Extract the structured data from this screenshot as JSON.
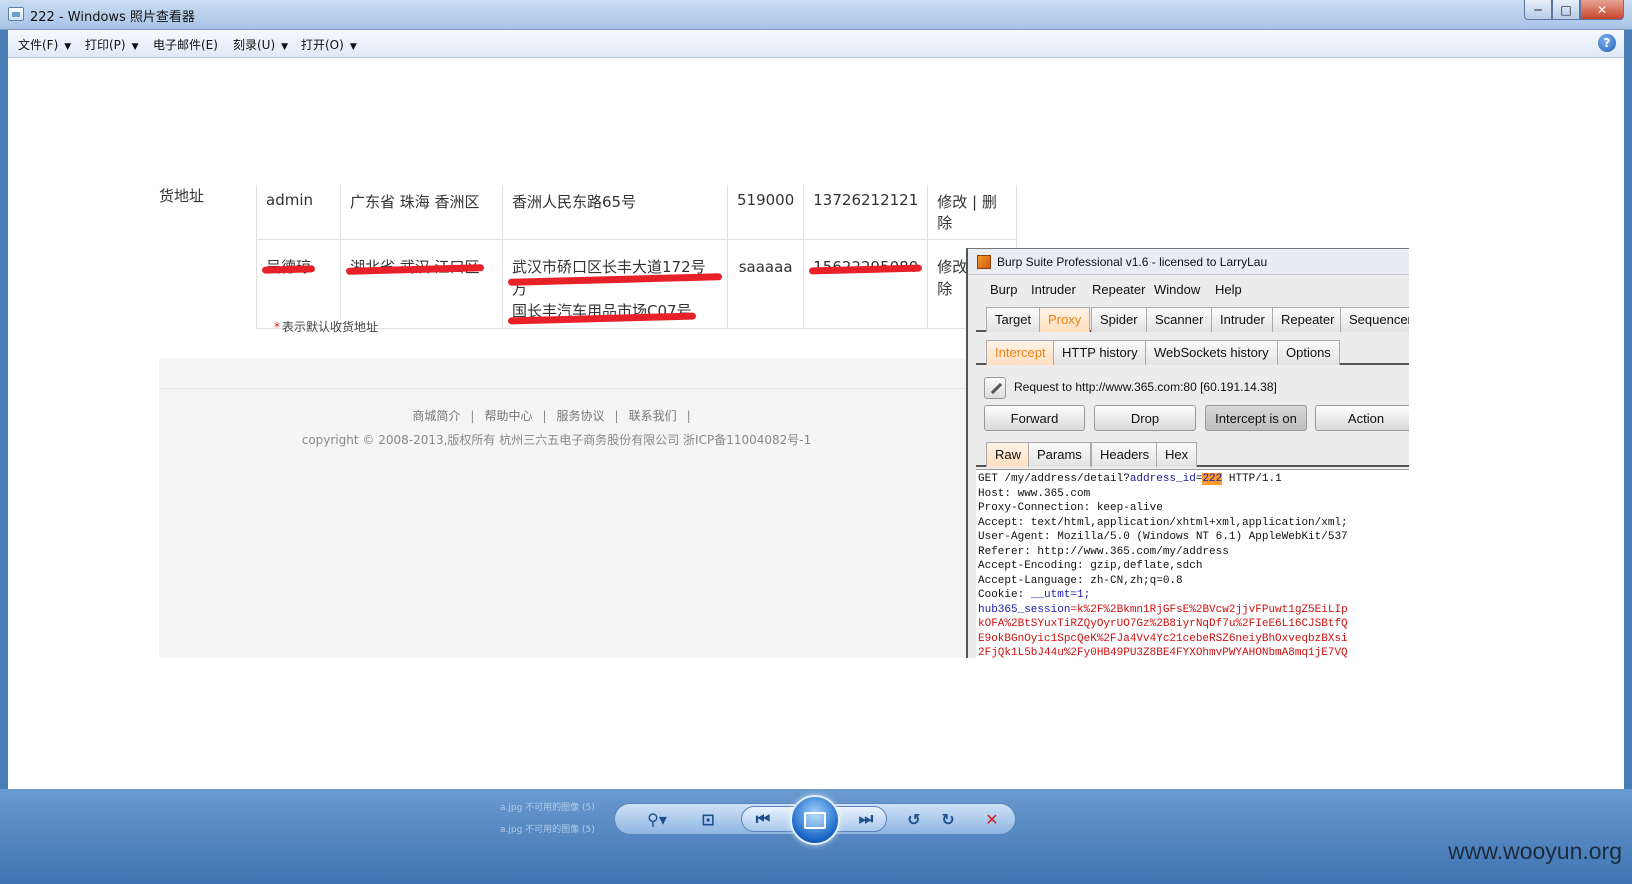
{
  "window": {
    "title": "222 - Windows 照片查看器",
    "minimize": "─",
    "maximize": "□",
    "close": "✕"
  },
  "menu": {
    "file": "文件(F)",
    "print": "打印(P)",
    "email": "电子邮件(E)",
    "burn": "刻录(U)",
    "open": "打开(O)",
    "help": "?"
  },
  "webpage": {
    "side_label": "货地址",
    "rows": [
      {
        "name": "admin",
        "region": "广东省 珠海 香洲区",
        "street": "香洲人民东路65号",
        "street2": "",
        "zip": "519000",
        "phone": "13726212121",
        "actions": "修改 | 删除"
      },
      {
        "name": "吴德琼",
        "region": "湖北省 武汉 江口区",
        "street": "武汉市硚口区长丰大道172号万",
        "street2": "国长丰汽车用品市场C07号",
        "zip": "saaaaa",
        "phone": "15622295080",
        "actions": "修改 | 删除"
      }
    ],
    "note_star": "*",
    "note": "表示默认收货地址",
    "footer_links": [
      "商城简介",
      "帮助中心",
      "服务协议",
      "联系我们"
    ],
    "footer_sep": "|",
    "copyright": "copyright © 2008-2013,版权所有 杭州三六五电子商务股份有限公司 浙ICP备11004082号-1"
  },
  "burp": {
    "title": "Burp Suite Professional v1.6 - licensed to LarryLau",
    "menu": [
      "Burp",
      "Intruder",
      "Repeater",
      "Window",
      "Help"
    ],
    "tabs": [
      "Target",
      "Proxy",
      "Spider",
      "Scanner",
      "Intruder",
      "Repeater",
      "Sequencer"
    ],
    "active_tab": "Proxy",
    "subtabs": [
      "Intercept",
      "HTTP history",
      "WebSockets history",
      "Options"
    ],
    "active_subtab": "Intercept",
    "request_info": "Request to http://www.365.com:80  [60.191.14.38]",
    "buttons": {
      "forward": "Forward",
      "drop": "Drop",
      "intercept": "Intercept is on",
      "action": "Action"
    },
    "view_tabs": [
      "Raw",
      "Params",
      "Headers",
      "Hex"
    ],
    "active_view_tab": "Raw",
    "request": {
      "method_path": "GET /my/address/detail?",
      "param_name": "address_id",
      "param_eq": "=",
      "param_value": "222",
      "protocol": " HTTP/1.1",
      "headers": [
        "Host: www.365.com",
        "Proxy-Connection: keep-alive",
        "Accept: text/html,application/xhtml+xml,application/xml;",
        "User-Agent: Mozilla/5.0 (Windows NT 6.1) AppleWebKit/537",
        "Referer: http://www.365.com/my/address",
        "Accept-Encoding: gzip,deflate,sdch",
        "Accept-Language: zh-CN,zh;q=0.8"
      ],
      "cookie_label": "Cookie: ",
      "cookie_first": "__utmt=1;",
      "session_name": "hub365_session",
      "session_value_lines": [
        "=k%2F%2Bkmn1RjGFsE%2BVcw2jjvFPuwt1gZ5EiLIp",
        "kOFA%2BtSYuxTiRZQyOyrUO7Gz%2B8iyrNqDf7u%2FIeE6L16CJSBtfQ",
        "E9okBGnOyic1SpcQeK%2FJa4Vv4Yc21cebeRSZ6neiyBhOxveqbzBXsi",
        "2FjQk1L5bJ44u%2Fy0HB49PU3Z8BE4FYXOhmvPWYAHONbmA8mq1jE7VQ"
      ]
    }
  },
  "controls": {
    "zoom": "⚲▾",
    "actual_size": "⊡",
    "previous": "⏮",
    "next": "⏭",
    "rotate_left": "↺",
    "rotate_right": "↻",
    "delete": "✕",
    "ghost_lines": [
      "a.jpg 不可用的图像 (5)",
      "a.jpg 不可用的图像 (5)"
    ]
  },
  "watermark": "www.wooyun.org",
  "colors": {
    "proxy_accent": "#f08010",
    "highlight": "#ff9b30",
    "redaction": "#e8202a",
    "session_text": "#d01010",
    "param_text": "#1a1aa6"
  }
}
